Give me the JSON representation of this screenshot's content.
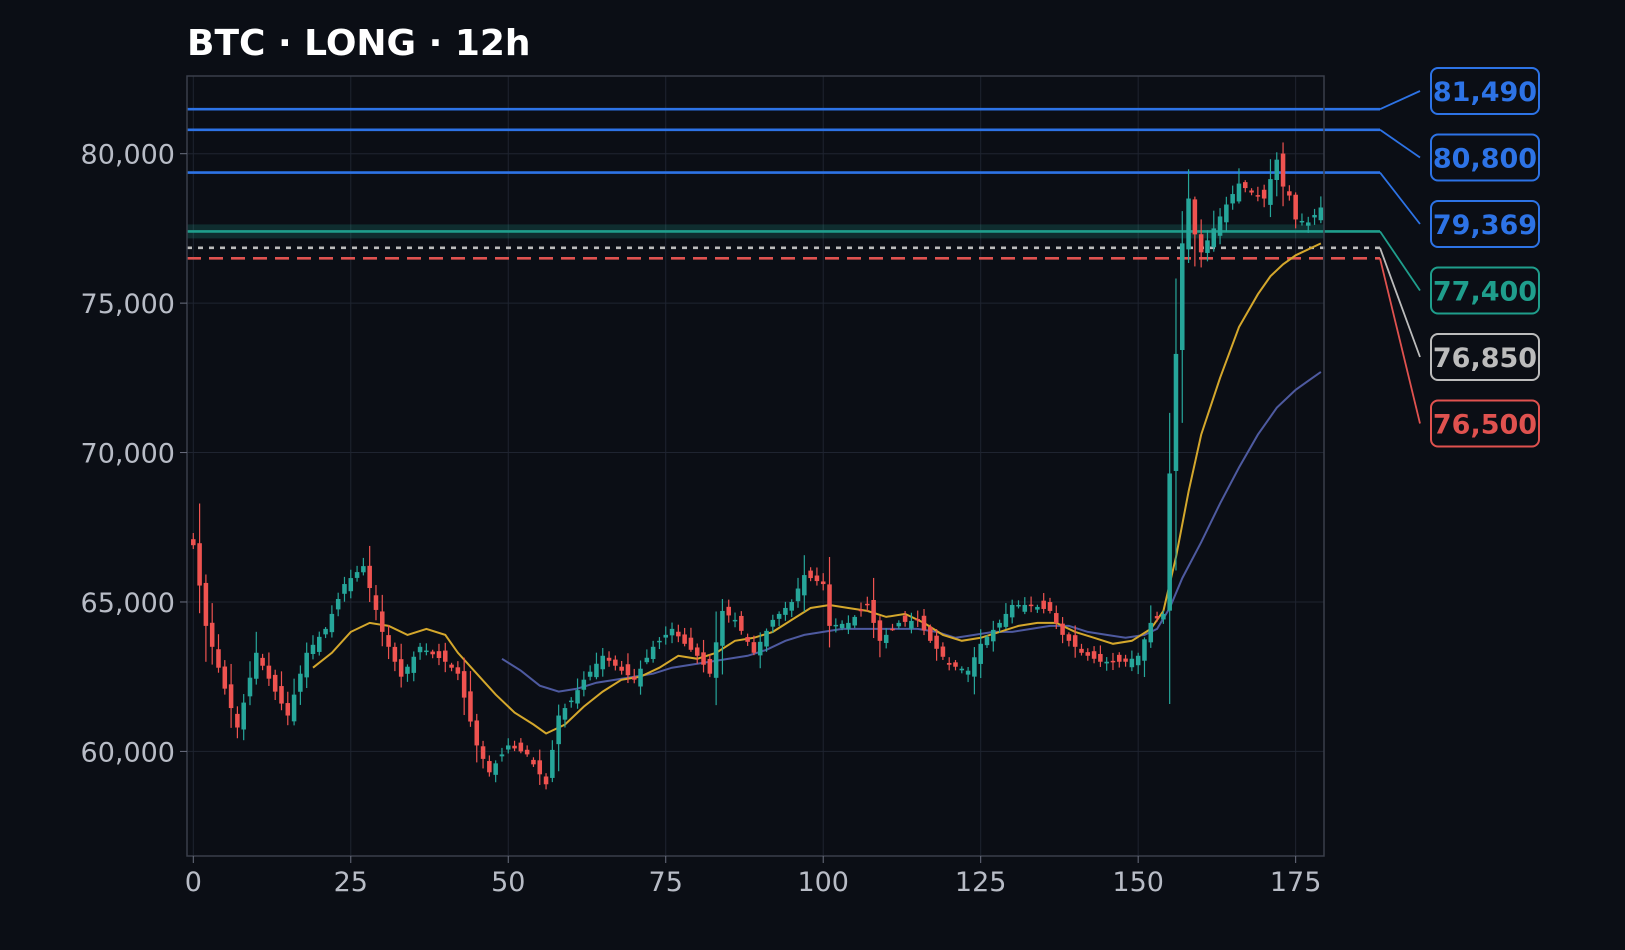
{
  "chart_data": {
    "type": "candlestick",
    "title": "BTC · LONG · 12h",
    "x_ticks": [
      0,
      25,
      50,
      75,
      100,
      125,
      150,
      175
    ],
    "y_ticks": [
      60000,
      65000,
      70000,
      75000,
      80000
    ],
    "xlim": [
      -1,
      179.5
    ],
    "ylim": [
      56500,
      82600
    ],
    "grid": true,
    "colors": {
      "background": "#0b0e15",
      "up": "#26a69a",
      "down": "#ef5350",
      "grid": "#1f2430",
      "frame": "#3a3f4b",
      "ma_fast": "#d4a72c",
      "ma_slow": "#4e5aa0"
    },
    "levels": [
      {
        "label": "81,490",
        "value": 81490,
        "color": "#2d73e6",
        "style": "solid"
      },
      {
        "label": "80,800",
        "value": 80800,
        "color": "#2d73e6",
        "style": "solid"
      },
      {
        "label": "79,369",
        "value": 79369,
        "color": "#2d73e6",
        "style": "solid"
      },
      {
        "label": "77,400",
        "value": 77400,
        "color": "#1f9e8c",
        "style": "band"
      },
      {
        "label": "76,850",
        "value": 76850,
        "color": "#bcbcbc",
        "style": "dotted"
      },
      {
        "label": "76,500",
        "value": 76500,
        "color": "#e0524f",
        "style": "dashed"
      }
    ],
    "close_anchors": [
      [
        0,
        66900
      ],
      [
        2,
        64200
      ],
      [
        5,
        62100
      ],
      [
        7,
        60800
      ],
      [
        10,
        63300
      ],
      [
        13,
        62000
      ],
      [
        15,
        61200
      ],
      [
        18,
        63300
      ],
      [
        21,
        64100
      ],
      [
        24,
        65600
      ],
      [
        27,
        66200
      ],
      [
        30,
        64000
      ],
      [
        33,
        62500
      ],
      [
        36,
        63500
      ],
      [
        40,
        63000
      ],
      [
        42,
        62600
      ],
      [
        45,
        60200
      ],
      [
        47,
        59300
      ],
      [
        50,
        60200
      ],
      [
        53,
        59900
      ],
      [
        56,
        58900
      ],
      [
        58,
        61200
      ],
      [
        60,
        61700
      ],
      [
        62,
        62400
      ],
      [
        65,
        63200
      ],
      [
        68,
        62700
      ],
      [
        70,
        62400
      ],
      [
        73,
        63500
      ],
      [
        76,
        64100
      ],
      [
        78,
        63600
      ],
      [
        80,
        63200
      ],
      [
        82,
        62600
      ],
      [
        84,
        64700
      ],
      [
        86,
        64400
      ],
      [
        89,
        63300
      ],
      [
        92,
        64400
      ],
      [
        95,
        65000
      ],
      [
        97,
        65900
      ],
      [
        100,
        65600
      ],
      [
        101,
        64200
      ],
      [
        104,
        64300
      ],
      [
        107,
        64900
      ],
      [
        109,
        63700
      ],
      [
        112,
        64300
      ],
      [
        115,
        64400
      ],
      [
        117,
        63700
      ],
      [
        120,
        62900
      ],
      [
        123,
        62700
      ],
      [
        125,
        63600
      ],
      [
        128,
        64300
      ],
      [
        130,
        64900
      ],
      [
        133,
        64900
      ],
      [
        136,
        64700
      ],
      [
        138,
        63900
      ],
      [
        141,
        63300
      ],
      [
        144,
        63000
      ],
      [
        148,
        63000
      ],
      [
        150,
        63200
      ],
      [
        152,
        64300
      ],
      [
        154,
        64600
      ],
      [
        155,
        69300
      ],
      [
        156,
        73300
      ],
      [
        157,
        77000
      ],
      [
        158,
        78500
      ],
      [
        159,
        77300
      ],
      [
        160,
        76700
      ],
      [
        162,
        77500
      ],
      [
        164,
        78300
      ],
      [
        166,
        79000
      ],
      [
        168,
        78700
      ],
      [
        170,
        78500
      ],
      [
        172,
        79800
      ],
      [
        173,
        78900
      ],
      [
        174,
        78600
      ],
      [
        175,
        77800
      ],
      [
        177,
        77700
      ],
      [
        179,
        78200
      ]
    ],
    "ma_fast_points": [
      [
        19,
        62800
      ],
      [
        22,
        63300
      ],
      [
        25,
        64000
      ],
      [
        28,
        64300
      ],
      [
        31,
        64200
      ],
      [
        34,
        63900
      ],
      [
        37,
        64100
      ],
      [
        40,
        63900
      ],
      [
        42,
        63300
      ],
      [
        45,
        62600
      ],
      [
        48,
        61900
      ],
      [
        51,
        61300
      ],
      [
        54,
        60900
      ],
      [
        56,
        60600
      ],
      [
        59,
        60900
      ],
      [
        62,
        61500
      ],
      [
        65,
        62000
      ],
      [
        68,
        62400
      ],
      [
        71,
        62500
      ],
      [
        74,
        62800
      ],
      [
        77,
        63200
      ],
      [
        80,
        63100
      ],
      [
        83,
        63300
      ],
      [
        86,
        63700
      ],
      [
        89,
        63800
      ],
      [
        92,
        64000
      ],
      [
        95,
        64400
      ],
      [
        98,
        64800
      ],
      [
        101,
        64900
      ],
      [
        104,
        64800
      ],
      [
        107,
        64700
      ],
      [
        110,
        64500
      ],
      [
        113,
        64600
      ],
      [
        116,
        64300
      ],
      [
        119,
        63900
      ],
      [
        122,
        63700
      ],
      [
        125,
        63800
      ],
      [
        128,
        64000
      ],
      [
        131,
        64200
      ],
      [
        134,
        64300
      ],
      [
        137,
        64300
      ],
      [
        140,
        64000
      ],
      [
        143,
        63800
      ],
      [
        146,
        63600
      ],
      [
        149,
        63700
      ],
      [
        152,
        64100
      ],
      [
        154,
        64700
      ],
      [
        156,
        66500
      ],
      [
        158,
        68700
      ],
      [
        160,
        70600
      ],
      [
        163,
        72500
      ],
      [
        166,
        74200
      ],
      [
        169,
        75300
      ],
      [
        171,
        75900
      ],
      [
        173,
        76300
      ],
      [
        175,
        76600
      ],
      [
        177,
        76800
      ],
      [
        179,
        77000
      ]
    ],
    "ma_slow_points": [
      [
        49,
        63100
      ],
      [
        52,
        62700
      ],
      [
        55,
        62200
      ],
      [
        58,
        62000
      ],
      [
        61,
        62100
      ],
      [
        64,
        62300
      ],
      [
        67,
        62400
      ],
      [
        70,
        62500
      ],
      [
        73,
        62600
      ],
      [
        76,
        62800
      ],
      [
        79,
        62900
      ],
      [
        82,
        63000
      ],
      [
        85,
        63100
      ],
      [
        88,
        63200
      ],
      [
        91,
        63400
      ],
      [
        94,
        63700
      ],
      [
        97,
        63900
      ],
      [
        100,
        64000
      ],
      [
        103,
        64100
      ],
      [
        106,
        64100
      ],
      [
        109,
        64100
      ],
      [
        112,
        64100
      ],
      [
        115,
        64100
      ],
      [
        118,
        64000
      ],
      [
        121,
        63800
      ],
      [
        124,
        63900
      ],
      [
        127,
        64000
      ],
      [
        130,
        64000
      ],
      [
        133,
        64100
      ],
      [
        136,
        64200
      ],
      [
        139,
        64200
      ],
      [
        142,
        64000
      ],
      [
        145,
        63900
      ],
      [
        148,
        63800
      ],
      [
        151,
        63900
      ],
      [
        153,
        64100
      ],
      [
        155,
        64800
      ],
      [
        157,
        65800
      ],
      [
        160,
        67000
      ],
      [
        163,
        68300
      ],
      [
        166,
        69500
      ],
      [
        169,
        70600
      ],
      [
        172,
        71500
      ],
      [
        175,
        72100
      ],
      [
        177,
        72400
      ],
      [
        179,
        72700
      ]
    ]
  }
}
